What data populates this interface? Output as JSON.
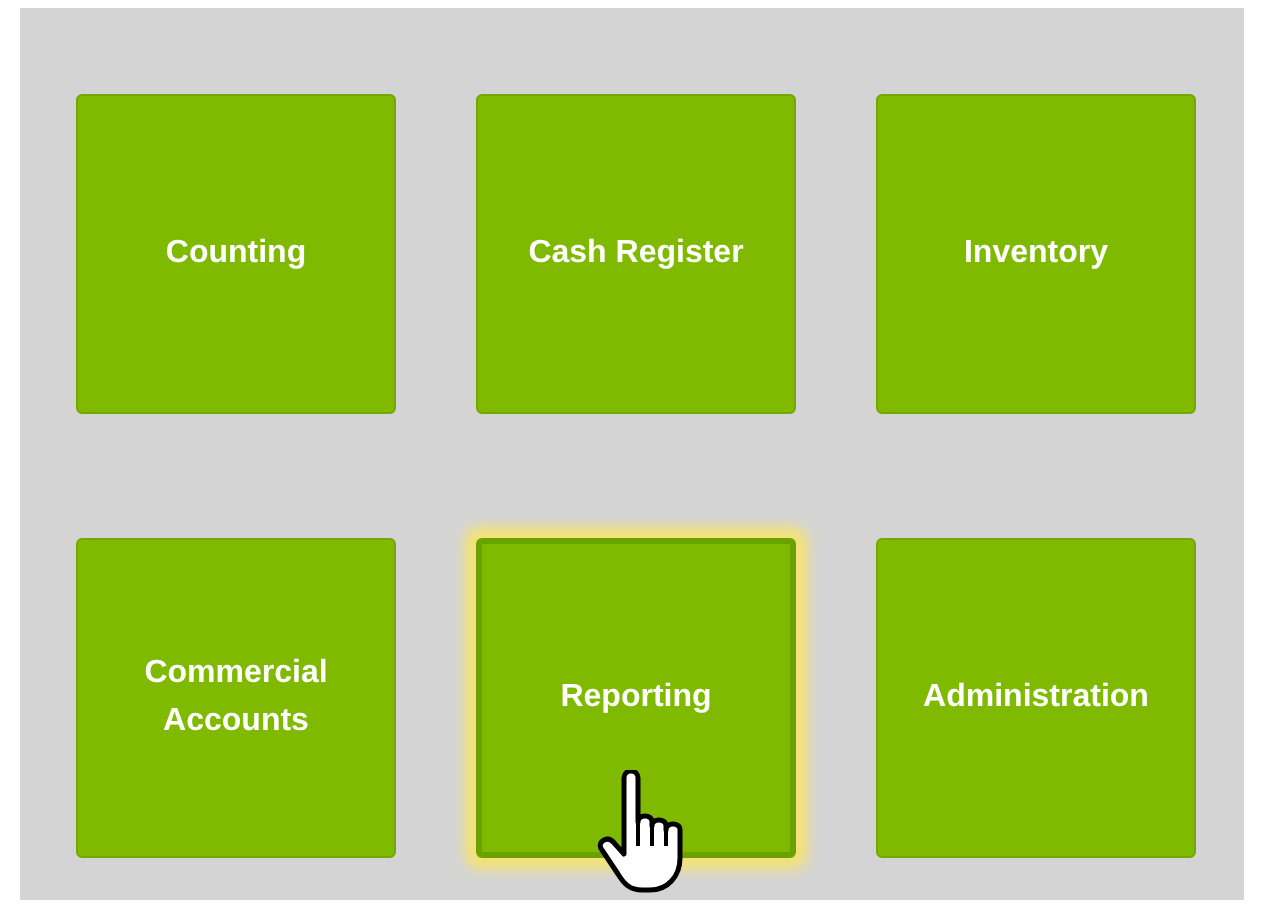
{
  "tiles": [
    {
      "label": "Counting",
      "selected": false
    },
    {
      "label": "Cash Register",
      "selected": false
    },
    {
      "label": "Inventory",
      "selected": false
    },
    {
      "label": "Commercial Accounts",
      "selected": false
    },
    {
      "label": "Reporting",
      "selected": true
    },
    {
      "label": "Administration",
      "selected": false
    }
  ]
}
